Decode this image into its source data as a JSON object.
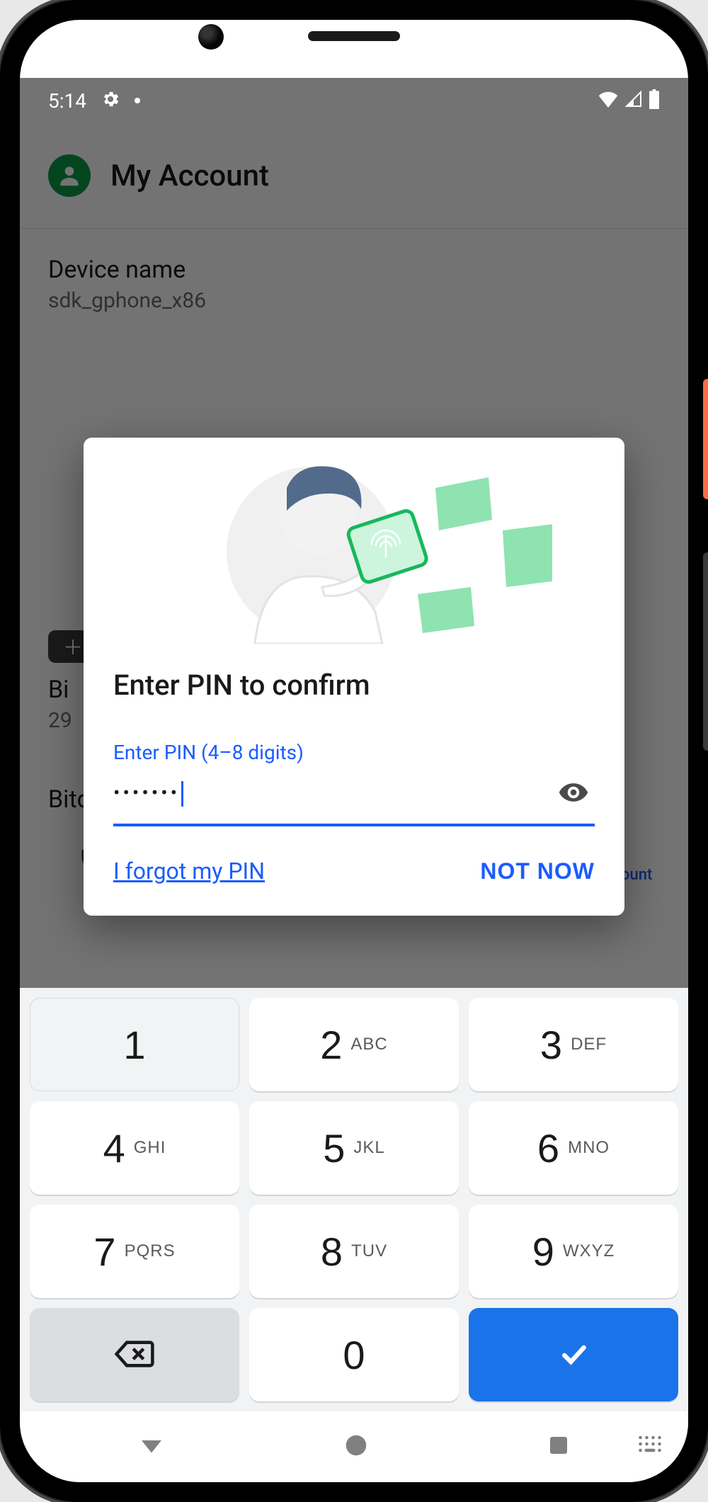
{
  "status": {
    "time": "5:14"
  },
  "header": {
    "title": "My Account"
  },
  "device_name": {
    "label": "Device name",
    "value": "sdk_gphone_x86"
  },
  "subscription": {
    "title_partial": "Bi",
    "value_partial": "29"
  },
  "vpn": {
    "title": "Bitdefender Premium VPN"
  },
  "nav": {
    "account_label": "My Account"
  },
  "dialog": {
    "title": "Enter PIN to confirm",
    "pin_label": "Enter PIN (4–8 digits)",
    "pin_masked": "•••••••",
    "forgot": "I forgot my PIN",
    "not_now": "NOT NOW"
  },
  "keypad": {
    "k1": "1",
    "k2": "2",
    "k3": "3",
    "k4": "4",
    "k5": "5",
    "k6": "6",
    "k7": "7",
    "k8": "8",
    "k9": "9",
    "k0": "0",
    "l2": "ABC",
    "l3": "DEF",
    "l4": "GHI",
    "l5": "JKL",
    "l6": "MNO",
    "l7": "PQRS",
    "l8": "TUV",
    "l9": "WXYZ"
  }
}
